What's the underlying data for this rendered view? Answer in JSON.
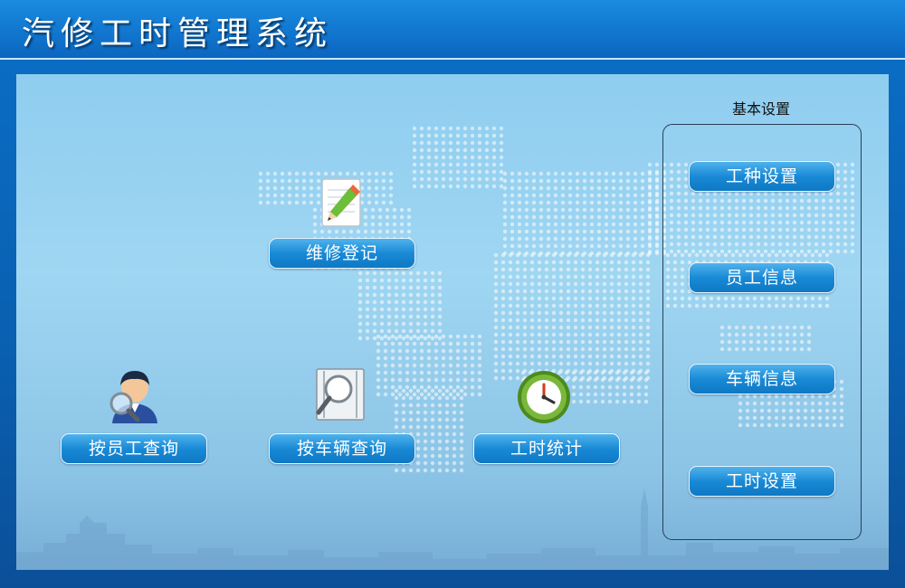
{
  "header": {
    "title": "汽修工时管理系统"
  },
  "main": {
    "repair_register": {
      "label": "维修登记",
      "icon": "pencil-notepad-icon"
    },
    "query_by_employee": {
      "label": "按员工查询",
      "icon": "person-magnifier-icon"
    },
    "query_by_vehicle": {
      "label": "按车辆查询",
      "icon": "document-magnifier-icon"
    },
    "work_hour_stats": {
      "label": "工时统计",
      "icon": "clock-icon"
    }
  },
  "basic_settings": {
    "title": "基本设置",
    "items": [
      {
        "label": "工种设置"
      },
      {
        "label": "员工信息"
      },
      {
        "label": "车辆信息"
      },
      {
        "label": "工时设置"
      }
    ]
  },
  "colors": {
    "header": "#0b66c0",
    "panel": "#9fd6f2",
    "button": "#1a8ad6"
  }
}
